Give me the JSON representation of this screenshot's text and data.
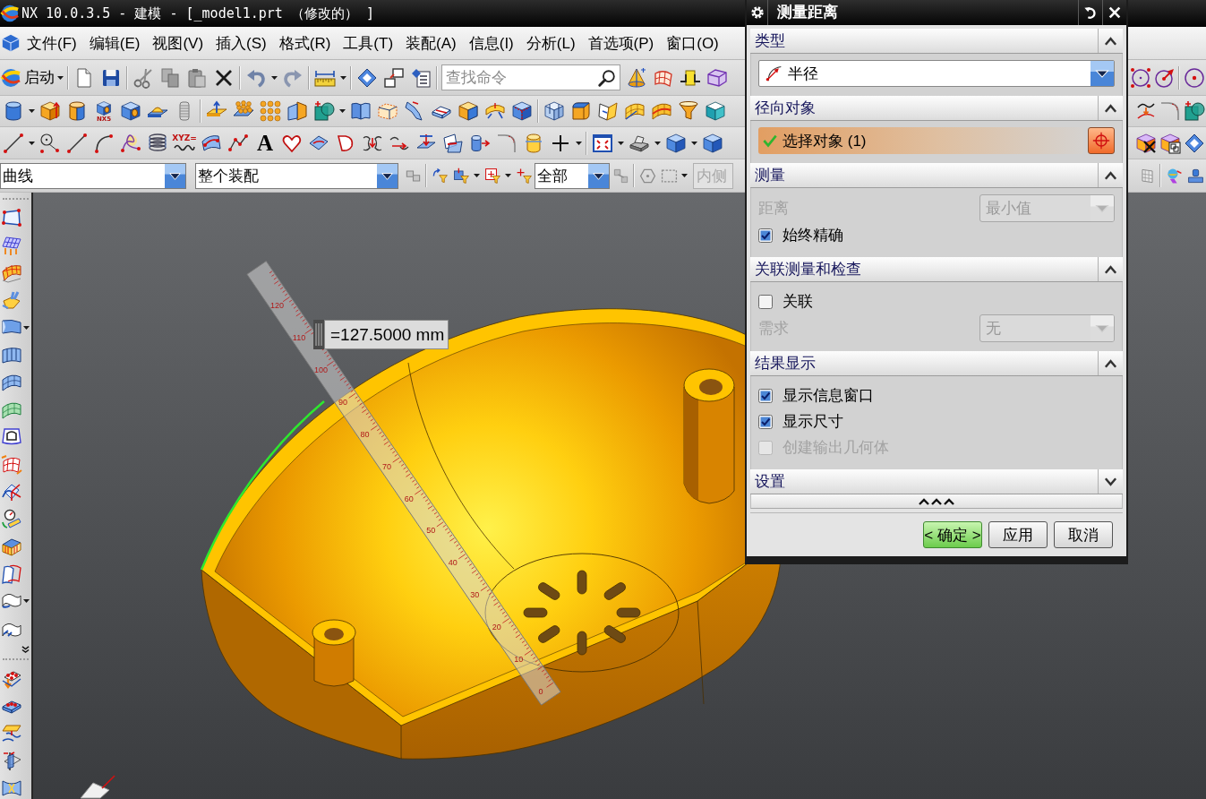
{
  "window": {
    "title": "NX 10.0.3.5 - 建模 - [_model1.prt （修改的） ]"
  },
  "menu": [
    "文件(F)",
    "编辑(E)",
    "视图(V)",
    "插入(S)",
    "格式(R)",
    "工具(T)",
    "装配(A)",
    "信息(I)",
    "分析(L)",
    "首选项(P)",
    "窗口(O)"
  ],
  "toolbar": {
    "start_button": "启动",
    "search": {
      "placeholder": "查找命令"
    },
    "block_badge": "NX5",
    "law_curve_label": "XYZ=",
    "text_tool": "A"
  },
  "selection_bar": {
    "type_filter": "曲线",
    "scope": "整个装配",
    "snap_filter": "全部",
    "inside_field": {
      "value": "内侧",
      "disabled": true
    }
  },
  "viewport": {
    "dimension": "=127.5000 mm",
    "ruler_labels": [
      "120",
      "110",
      "100",
      "90",
      "80",
      "70",
      "60",
      "50",
      "40",
      "30",
      "20",
      "10",
      "0"
    ]
  },
  "dialog": {
    "title": "测量距离",
    "sections": [
      {
        "title": "类型",
        "expanded": true,
        "rows": [
          {
            "kind": "dropdown",
            "value": "半径",
            "disabled": false
          }
        ]
      },
      {
        "title": "径向对象",
        "expanded": true,
        "rows": [
          {
            "kind": "selection",
            "label": "选择对象 (1)",
            "active": true,
            "complete": true
          }
        ]
      },
      {
        "title": "测量",
        "expanded": true,
        "rows": [
          {
            "kind": "labeled_dropdown",
            "label": "距离",
            "value": "最小值",
            "disabled": true
          },
          {
            "kind": "checkbox",
            "label": "始终精确",
            "checked": true,
            "disabled": false
          }
        ]
      },
      {
        "title": "关联测量和检查",
        "expanded": true,
        "rows": [
          {
            "kind": "checkbox",
            "label": "关联",
            "checked": false,
            "disabled": false
          },
          {
            "kind": "labeled_dropdown",
            "label": "需求",
            "value": "无",
            "disabled": true
          }
        ]
      },
      {
        "title": "结果显示",
        "expanded": true,
        "rows": [
          {
            "kind": "checkbox",
            "label": "显示信息窗口",
            "checked": true,
            "disabled": false
          },
          {
            "kind": "checkbox",
            "label": "显示尺寸",
            "checked": true,
            "disabled": false
          },
          {
            "kind": "checkbox",
            "label": "创建输出几何体",
            "checked": false,
            "disabled": true
          }
        ]
      },
      {
        "title": "设置",
        "expanded": false
      }
    ],
    "buttons": [
      {
        "label": "< 确定 >",
        "kind": "default"
      },
      {
        "label": "应用",
        "kind": "normal"
      },
      {
        "label": "取消",
        "kind": "normal"
      }
    ]
  }
}
